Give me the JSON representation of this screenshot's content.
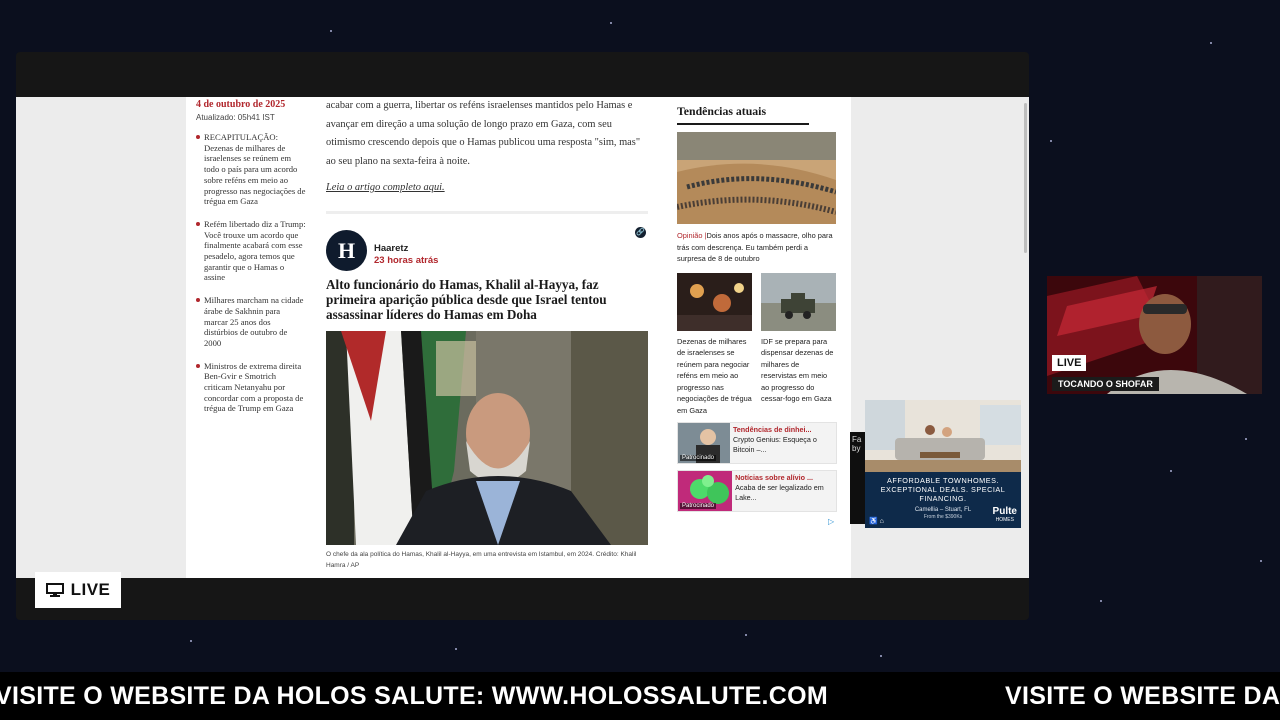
{
  "live_blog": {
    "date": "4 de outubro de 2025",
    "updated": "Atualizado: 05h41 IST",
    "items": [
      "RECAPITULAÇÃO: Dezenas de milhares de israelenses se reúnem em todo o país para um acordo sobre reféns em meio ao progresso nas negociações de trégua em Gaza",
      "Refém libertado diz a Trump: Você trouxe um acordo que finalmente acabará com esse pesadelo, agora temos que garantir que o Hamas o assine",
      "Milhares marcham na cidade árabe de Sakhnin para marcar 25 anos dos distúrbios de outubro de 2000",
      "Ministros de extrema direita Ben-Gvir e Smotrich criticam Netanyahu por concordar com a proposta de trégua de Trump em Gaza"
    ]
  },
  "article": {
    "paragraph": "acabar com a guerra, libertar os reféns israelenses mantidos pelo Hamas e avançar em direção a uma solução de longo prazo em Gaza, com seu otimismo crescendo depois que o Hamas publicou uma resposta \"sim, mas\" ao seu plano na sexta-feira à noite.",
    "read_more": "Leia o artigo completo aqui.",
    "post": {
      "avatar_letter": "H",
      "source": "Haaretz",
      "time": "23 horas atrás",
      "headline": "Alto funcionário do Hamas, Khalil al-Hayya, faz primeira aparição pública desde que Israel tentou assassinar líderes do Hamas em Doha",
      "caption": "O chefe da ala política do Hamas, Khalil al-Hayya, em uma entrevista em Istambul, em 2024.   Crédito: Khalil Hamra / AP"
    }
  },
  "trending": {
    "title": "Tendências atuais",
    "main": {
      "tag": "Opinião |",
      "text": "Dois anos após o massacre, olho para trás com descrença. Eu também perdi a surpresa de 8 de outubro"
    },
    "pair": [
      "Dezenas de milhares de israelenses se reúnem para negociar reféns em meio ao progresso nas negociações de trégua em Gaza",
      "IDF se prepara para dispensar dezenas de milhares de reservistas em meio ao progresso do cessar-fogo em Gaza"
    ],
    "sponsored": [
      {
        "title": "Tendências de dinhei...",
        "text": "Crypto Genius: Esqueça o Bitcoin –...",
        "badge": "Patrocinado"
      },
      {
        "title": "Notícias sobre alívio ...",
        "text": "Acaba de ser legalizado em Lake...",
        "badge": "Patrocinado"
      }
    ]
  },
  "ad": {
    "side_text": "Fa by",
    "headline": "AFFORDABLE TOWNHOMES. EXCEPTIONAL DEALS. SPECIAL FINANCING.",
    "location": "Camellia – Stuart, FL",
    "from_price": "From the $390Ks",
    "logo": "Pulte",
    "logo_sub": "HOMES"
  },
  "stream": {
    "live_label": "LIVE",
    "cam_live": "LIVE",
    "cam_label": "TOCANDO O SHOFAR",
    "ticker": "VISITE O WEBSITE DA HOLOS SALUTE: WWW.HOLOSSALUTE.COM"
  }
}
